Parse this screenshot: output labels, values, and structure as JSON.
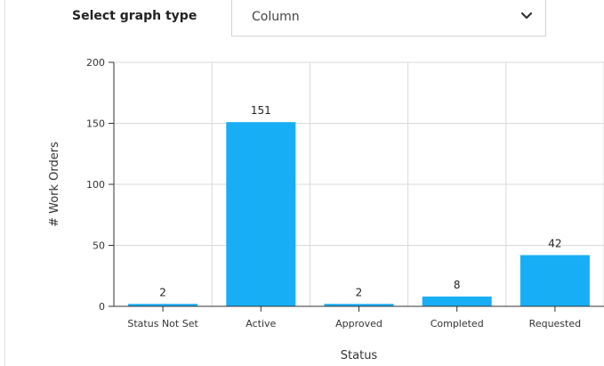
{
  "controls": {
    "graph_type_label": "Select graph type",
    "graph_type_value": "Column",
    "graph_type_icon": "chevron-down-icon"
  },
  "colors": {
    "bar": "#18aef5",
    "grid": "#d9d9d9",
    "axis": "#333333"
  },
  "chart_data": {
    "type": "bar",
    "categories": [
      "Status Not Set",
      "Active",
      "Approved",
      "Completed",
      "Requested"
    ],
    "values": [
      2,
      151,
      2,
      8,
      42
    ],
    "title": "",
    "xlabel": "Status",
    "ylabel": "# Work Orders",
    "ylim": [
      0,
      200
    ],
    "yticks": [
      0,
      50,
      100,
      150,
      200
    ],
    "data_labels": [
      "2",
      "151",
      "2",
      "8",
      "42"
    ],
    "grid": true,
    "legend": "none"
  }
}
